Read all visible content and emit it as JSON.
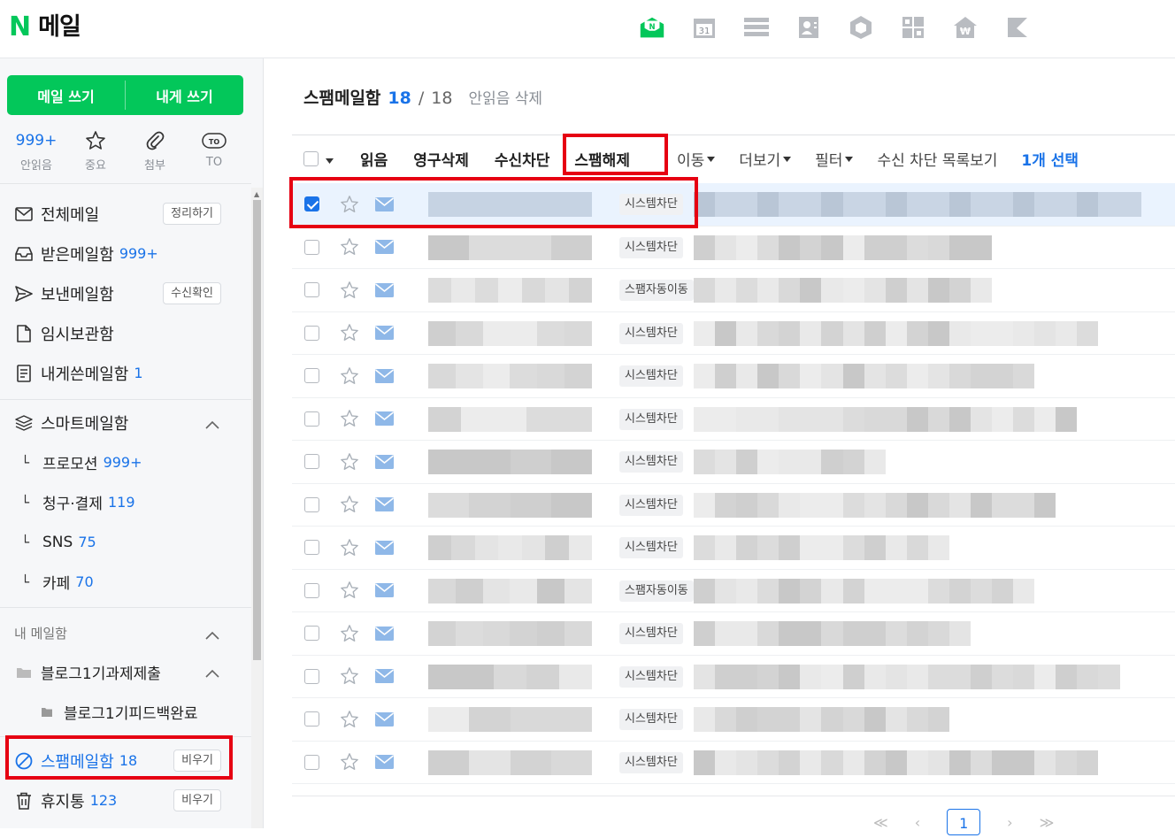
{
  "app": {
    "logo_letter": "N",
    "title": "메일"
  },
  "apps": [
    {
      "icon": "mail-app-icon",
      "label": "N"
    },
    {
      "icon": "calendar-app-icon",
      "label": "31"
    },
    {
      "icon": "list-app-icon"
    },
    {
      "icon": "contacts-app-icon"
    },
    {
      "icon": "box-app-icon"
    },
    {
      "icon": "office-app-icon"
    },
    {
      "icon": "pay-app-icon"
    },
    {
      "icon": "memo-app-icon"
    }
  ],
  "sidebar": {
    "write_mail": "메일 쓰기",
    "write_self": "내게 쓰기",
    "quick": [
      {
        "value": "999+",
        "label": "안읽음"
      },
      {
        "value": "",
        "label": "중요"
      },
      {
        "value": "",
        "label": "첨부"
      },
      {
        "value": "",
        "label": "TO"
      }
    ],
    "folders": [
      {
        "label": "전체메일",
        "pill": "정리하기"
      },
      {
        "label": "받은메일함",
        "count": "999+"
      },
      {
        "label": "보낸메일함",
        "pill": "수신확인"
      },
      {
        "label": "임시보관함"
      },
      {
        "label": "내게쓴메일함",
        "count": "1"
      }
    ],
    "smart": {
      "label": "스마트메일함",
      "items": [
        {
          "label": "프로모션",
          "count": "999+"
        },
        {
          "label": "청구·결제",
          "count": "119"
        },
        {
          "label": "SNS",
          "count": "75"
        },
        {
          "label": "카페",
          "count": "70"
        }
      ]
    },
    "my_label": "내 메일함",
    "my_folder": "블로그1기과제제출",
    "my_subfolder": "블로그1기피드백완료",
    "spam": {
      "label": "스팸메일함",
      "count": "18",
      "pill": "비우기"
    },
    "trash": {
      "label": "휴지통",
      "count": "123",
      "pill": "비우기"
    }
  },
  "main": {
    "title": "스팸메일함",
    "count": "18",
    "sep": "/",
    "total": "18",
    "delete_unread": "안읽음 삭제",
    "toolbar": {
      "read": "읽음",
      "perm_delete": "영구삭제",
      "block": "수신차단",
      "unspam": "스팸해제",
      "move": "이동",
      "more": "더보기",
      "filter": "필터",
      "block_list": "수신 차단 목록보기",
      "selected": "1개 선택"
    },
    "rows": [
      {
        "tag": "시스템차단",
        "checked": true
      },
      {
        "tag": "시스템차단",
        "checked": false
      },
      {
        "tag": "스팸자동이동",
        "checked": false
      },
      {
        "tag": "시스템차단",
        "checked": false
      },
      {
        "tag": "시스템차단",
        "checked": false
      },
      {
        "tag": "시스템차단",
        "checked": false
      },
      {
        "tag": "시스템차단",
        "checked": false
      },
      {
        "tag": "시스템차단",
        "checked": false
      },
      {
        "tag": "시스템차단",
        "checked": false
      },
      {
        "tag": "스팸자동이동",
        "checked": false
      },
      {
        "tag": "시스템차단",
        "checked": false
      },
      {
        "tag": "시스템차단",
        "checked": false
      },
      {
        "tag": "시스템차단",
        "checked": false
      },
      {
        "tag": "시스템차단",
        "checked": false
      }
    ],
    "pager": {
      "first": "≪",
      "prev": "‹",
      "current": "1",
      "next": "›",
      "last": "≫"
    }
  },
  "colors": {
    "brand": "#03c75a",
    "accent": "#1a73e8",
    "highlight": "#e60012"
  }
}
